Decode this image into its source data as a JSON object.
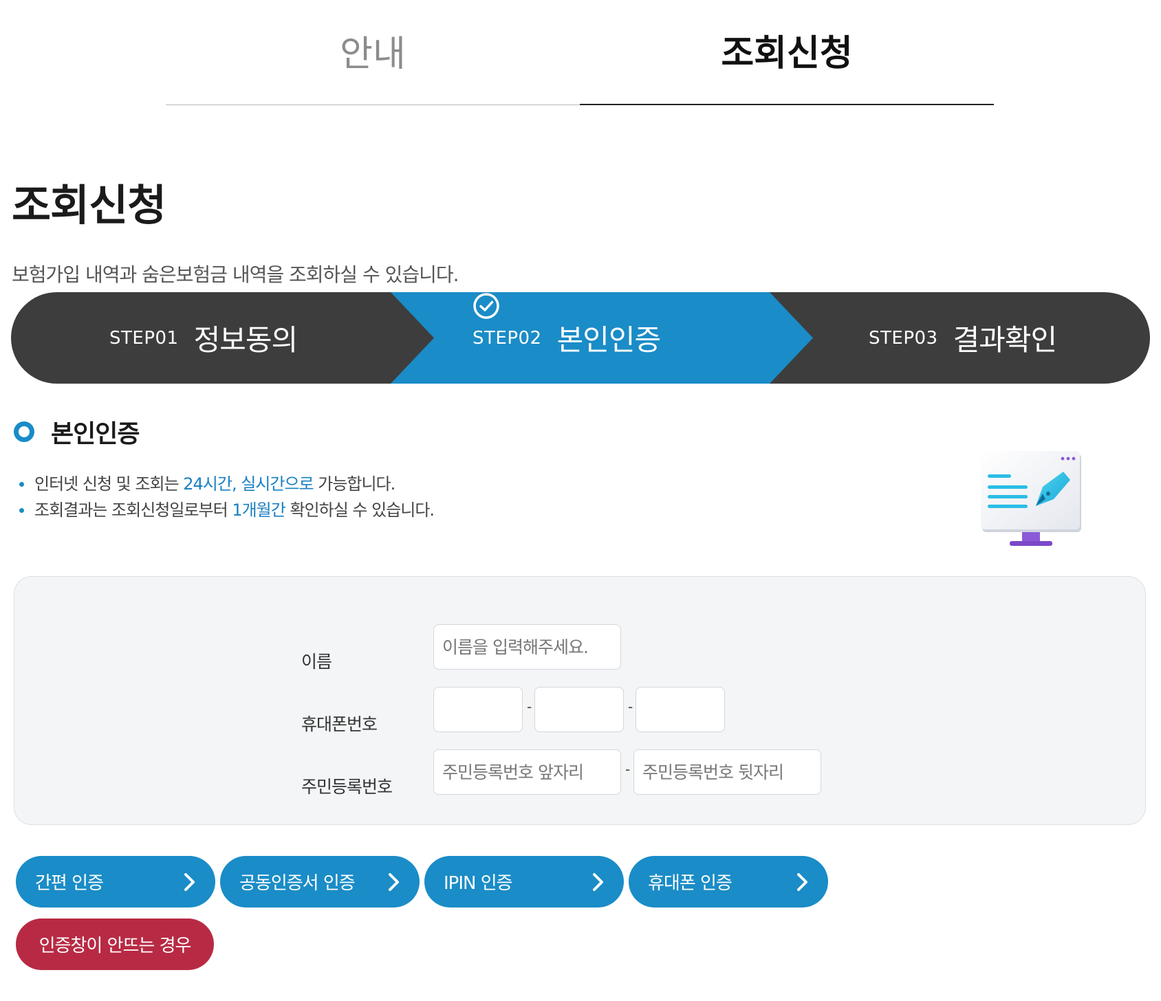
{
  "tabs": {
    "guide": "안내",
    "request": "조회신청"
  },
  "page": {
    "title": "조회신청",
    "description": "보험가입 내역과 숨은보험금 내역을 조회하실 수 있습니다."
  },
  "steps": [
    {
      "num": "STEP01",
      "name": "정보동의"
    },
    {
      "num": "STEP02",
      "name": "본인인증"
    },
    {
      "num": "STEP03",
      "name": "결과확인"
    }
  ],
  "section": {
    "title": "본인인증",
    "notes": [
      {
        "pre": "인터넷 신청 및 조회는 ",
        "hl": "24시간, 실시간으로",
        "post": " 가능합니다."
      },
      {
        "pre": "조회결과는 조회신청일로부터 ",
        "hl": "1개월간",
        "post": " 확인하실 수 있습니다."
      }
    ]
  },
  "form": {
    "name_label": "이름",
    "name_placeholder": "이름을 입력해주세요.",
    "phone_label": "휴대폰번호",
    "rrn_label": "주민등록번호",
    "rrn_front_placeholder": "주민등록번호 앞자리",
    "rrn_back_placeholder": "주민등록번호 뒷자리",
    "dash": "-"
  },
  "buttons": {
    "simple": "간편 인증",
    "cert": "공동인증서 인증",
    "ipin": "IPIN 인증",
    "phone": "휴대폰 인증",
    "help": "인증창이 안뜨는 경우"
  },
  "colors": {
    "primary": "#1a8cc7",
    "dark": "#3d3d3d",
    "danger": "#b82a44",
    "panel": "#f3f5f7"
  },
  "icons": {
    "step_check": "check-circle-icon",
    "button_arrow": "chevron-right-icon",
    "section_bullet": "ring-icon",
    "illustration": "monitor-pen-icon"
  }
}
